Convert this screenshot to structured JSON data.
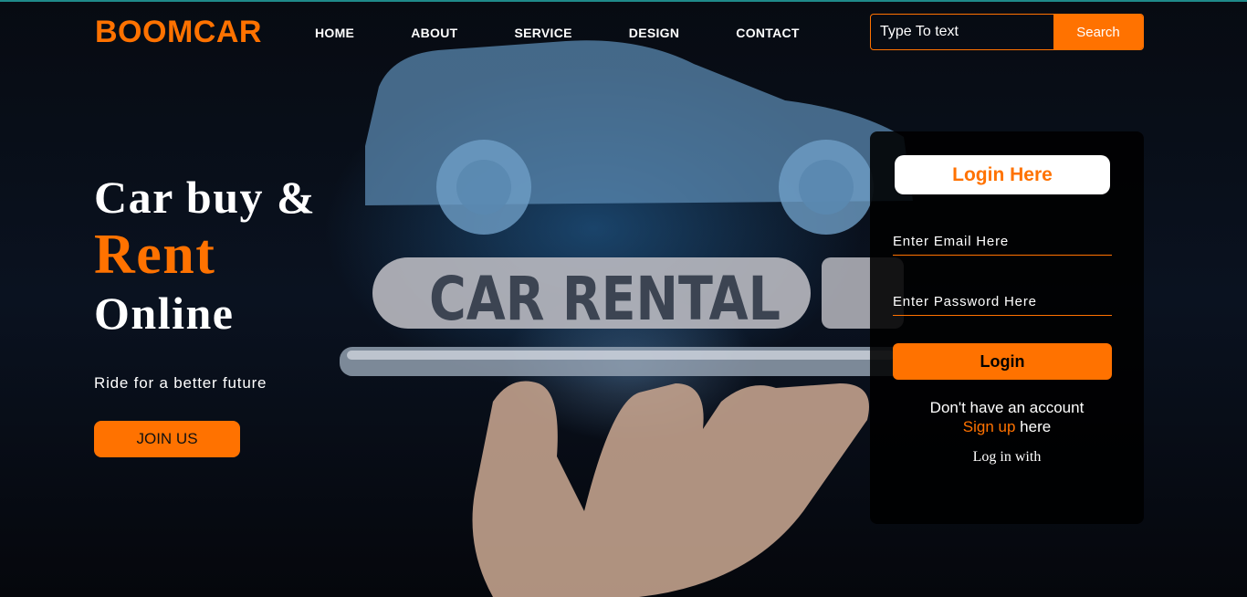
{
  "header": {
    "logo": "BOOMCAR",
    "nav": [
      "HOME",
      "ABOUT",
      "SERVICE",
      "DESIGN",
      "CONTACT"
    ],
    "search": {
      "placeholder": "Type To text",
      "button_label": "Search"
    }
  },
  "hero": {
    "line1": "Car buy &",
    "line2": "Rent",
    "line3": "Online",
    "tagline": "Ride for a better future",
    "join_label": "JOIN US",
    "image_sign_text": "CAR RENTAL"
  },
  "login": {
    "title": "Login Here",
    "email_placeholder": "Enter Email Here",
    "password_placeholder": "Enter Password Here",
    "button_label": "Login",
    "no_account_text": "Don't have an account",
    "signup_link": "Sign up",
    "signup_suffix": " here",
    "login_with": "Log in with"
  },
  "colors": {
    "accent": "#ff7200",
    "background": "#05070c",
    "card": "#000000"
  }
}
